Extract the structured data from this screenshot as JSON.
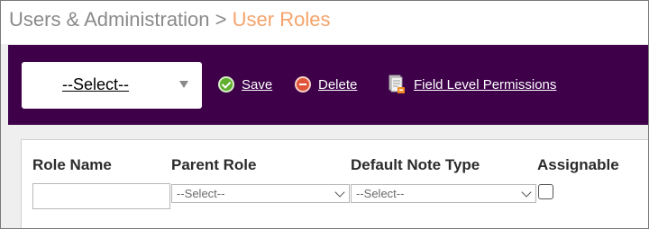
{
  "breadcrumb": {
    "root": "Users & Administration",
    "separator": ">",
    "current": "User Roles"
  },
  "toolbar": {
    "select_value": "--Select--",
    "save_label": "Save",
    "delete_label": "Delete",
    "field_permissions_label": "Field Level Permissions"
  },
  "form": {
    "columns": [
      "Role Name",
      "Parent Role",
      "Default Note Type",
      "Assignable"
    ],
    "role_name_value": "",
    "parent_role_value": "--Select--",
    "default_note_type_value": "--Select--",
    "assignable_checked": false
  },
  "colors": {
    "toolbar_bg": "#3d0049",
    "breadcrumb_current": "#f5a36a",
    "save_icon": "#5fae2e",
    "delete_icon": "#e0553a"
  }
}
